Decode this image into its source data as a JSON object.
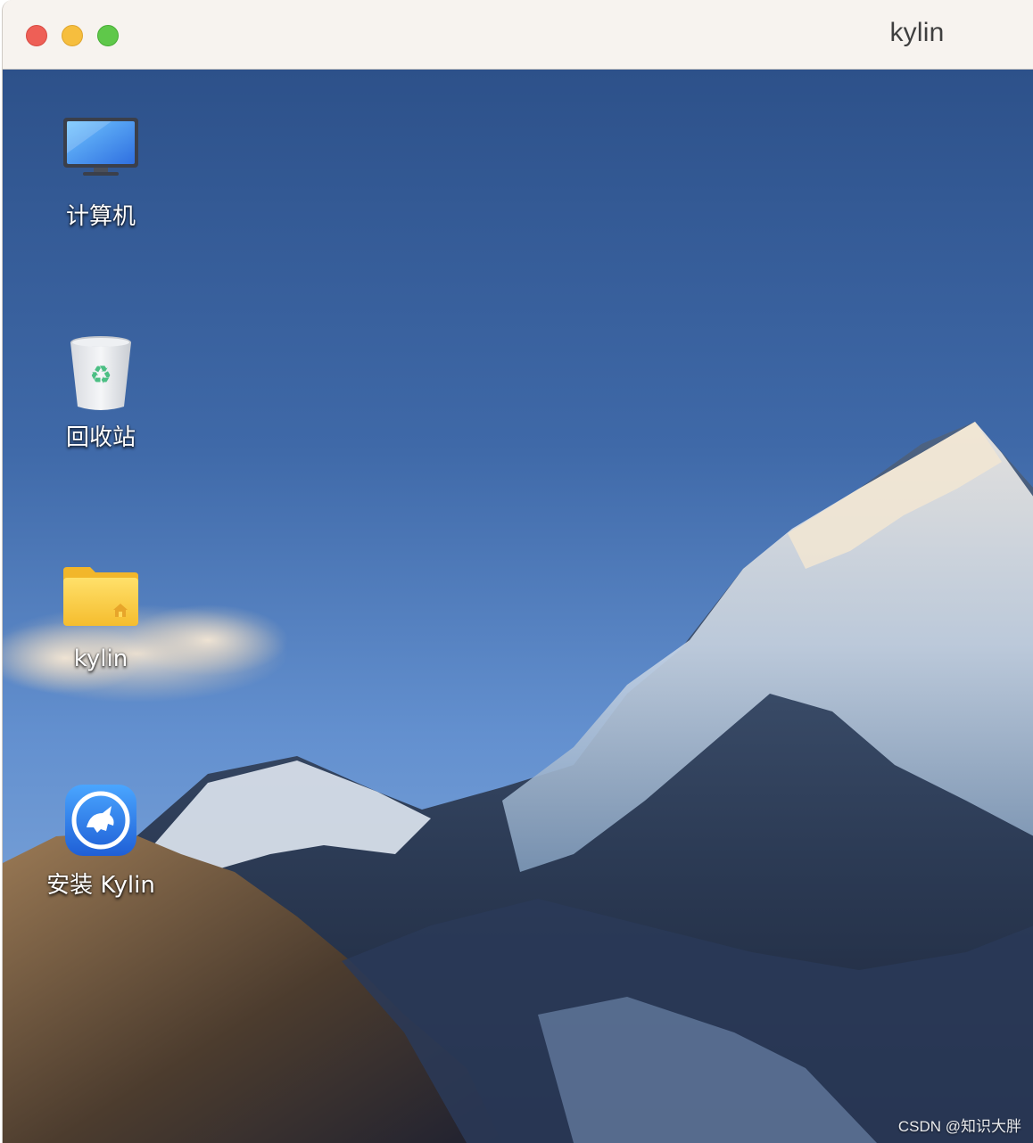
{
  "window": {
    "title": "kylin",
    "controls": {
      "close_color": "#ee5f56",
      "minimize_color": "#f6be3e",
      "zoom_color": "#5fc84a"
    }
  },
  "desktop": {
    "wallpaper": "snowy-mountain-blue-sky",
    "icons": [
      {
        "name": "computer-icon",
        "label": "计算机"
      },
      {
        "name": "trash-icon",
        "label": "回收站"
      },
      {
        "name": "home-folder-icon",
        "label": "kylin"
      },
      {
        "name": "kylin-installer-icon",
        "label": "安装 Kylin"
      }
    ]
  },
  "watermark": "CSDN @知识大胖"
}
